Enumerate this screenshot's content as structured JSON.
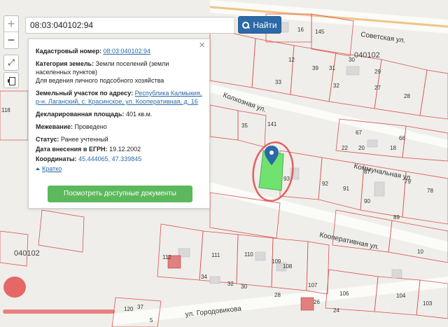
{
  "search": {
    "value": "08:03:040102:94",
    "button_label": "Найти"
  },
  "controls": {
    "zoom_in": "+",
    "zoom_out": "−",
    "expand": "⤢"
  },
  "popup": {
    "close": "×",
    "cadastral_label": "Кадастровый номер:",
    "cadastral_value": "08:03:040102:94",
    "category_label": "Категория земель:",
    "category_value": "Земли поселений (земли населенных пунктов)",
    "usage": "Для ведения личного подсобного хозяйства",
    "address_label": "Земельный участок по адресу:",
    "address_value": "Республика Калмыкия, р-н. Лаганский, с. Красинское, ул. Кооперативная, д. 16",
    "area_label": "Декларированная площадь:",
    "area_value": "401 кв.м.",
    "survey_label": "Межевание:",
    "survey_value": "Проведено",
    "status_label": "Статус:",
    "status_value": "Ранее учтенный",
    "date_label": "Дата внесения в ЕГРН:",
    "date_value": "19.12.2002",
    "coords_label": "Координаты:",
    "coords_value": "45.444065, 47.339845",
    "brief_link": "Кратко",
    "docs_button": "Посмотреть доступные документы"
  },
  "map": {
    "block_labels": {
      "block_top": "040102",
      "block_left": "040102"
    },
    "streets": {
      "sovetskaya": "Советская ул.",
      "kolkhoznaya": "Колхозная ул.",
      "kommunalnaya": "Коммунальная ул.",
      "kooperativnaya": "Кооперативная ул.",
      "gorodovikova": "ул. Городовикова"
    },
    "parcels": {
      "p16": "16",
      "p145": "145",
      "p12": "12",
      "p39": "39",
      "p31": "31",
      "p30": "30",
      "p29": "29",
      "p33": "33",
      "p32": "32",
      "p27": "27",
      "p28": "28",
      "p118": "118",
      "p35": "35",
      "p141": "141",
      "p67": "67",
      "p66": "66",
      "p22": "22",
      "p20": "20",
      "p18": "18",
      "p93": "93",
      "p92": "92",
      "p91": "91",
      "p90": "90",
      "p87": "87",
      "p89": "89",
      "p79": "79",
      "p78": "78",
      "p10": "10",
      "p112": "112",
      "p111": "111",
      "p110": "110",
      "p109": "109",
      "p108": "108",
      "p107": "107",
      "p106": "106",
      "p104": "104",
      "p103": "103",
      "p34": "34",
      "p32b": "32",
      "p30b": "30",
      "p28b": "28",
      "p26": "26",
      "p24": "24",
      "p120": "120",
      "p37": "37",
      "p5": "5"
    },
    "marker_color": "#2b6aa6",
    "selected_color": "#6fe26f",
    "boundary_color": "#d9534f"
  }
}
